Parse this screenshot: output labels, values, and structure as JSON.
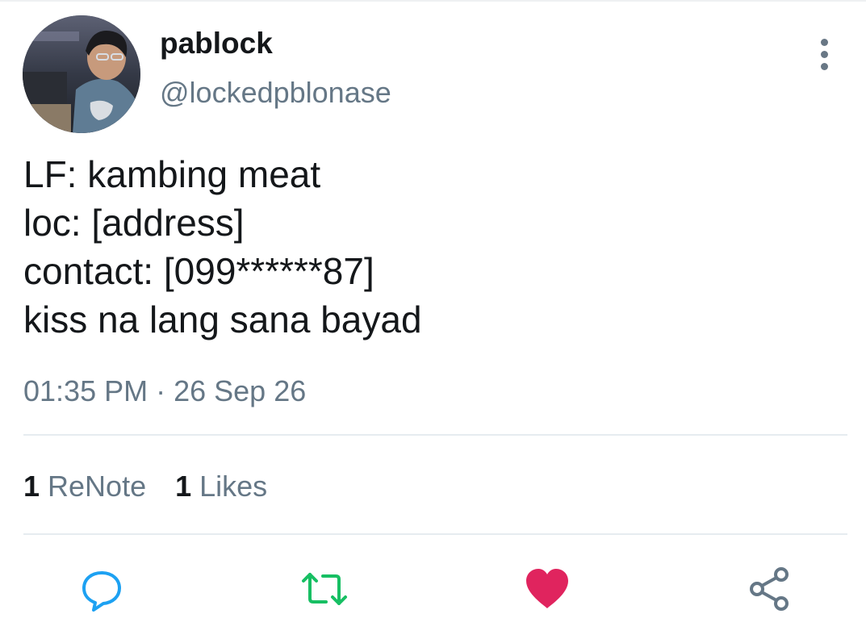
{
  "author": {
    "display_name": "pablock",
    "handle": "@lockedpblonase"
  },
  "note": {
    "lines": [
      "LF: kambing meat",
      "loc: [address]",
      "contact: [099******87]",
      "kiss na lang sana bayad"
    ]
  },
  "meta": {
    "time": "01:35 PM",
    "separator": "·",
    "date": "26 Sep 26"
  },
  "stats": {
    "renotes_count": "1",
    "renotes_label": "ReNote",
    "likes_count": "1",
    "likes_label": "Likes"
  },
  "actions": [
    {
      "icon": "reply-icon"
    },
    {
      "icon": "renote-icon"
    },
    {
      "icon": "heart-icon"
    },
    {
      "icon": "share-icon"
    }
  ],
  "colors": {
    "text_primary": "#14171a",
    "text_secondary": "#657786",
    "icon_blue": "#1da1f2",
    "renote_green": "#17bf63",
    "like_red": "#e0245e",
    "divider": "#e6ecf0"
  }
}
